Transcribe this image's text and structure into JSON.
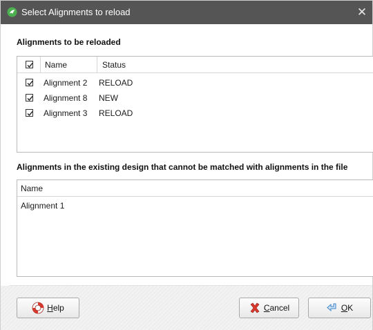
{
  "dialog": {
    "title": "Select Alignments to reload",
    "close_glyph": "✕"
  },
  "reload_section": {
    "heading": "Alignments to be reloaded",
    "columns": {
      "name": "Name",
      "status": "Status"
    },
    "header_checked": true,
    "rows": [
      {
        "checked": true,
        "name": "Alignment 2",
        "status": "RELOAD"
      },
      {
        "checked": true,
        "name": "Alignment 8",
        "status": "NEW"
      },
      {
        "checked": true,
        "name": "Alignment 3",
        "status": "RELOAD"
      }
    ]
  },
  "unmatched_section": {
    "heading": "Alignments in the existing design that cannot be matched with alignments in the file",
    "columns": {
      "name": "Name"
    },
    "rows": [
      {
        "name": "Alignment 1"
      }
    ]
  },
  "buttons": {
    "help": {
      "mnemonic": "H",
      "rest": "elp",
      "icon": "lifebuoy-icon"
    },
    "cancel": {
      "mnemonic": "C",
      "rest": "ancel",
      "icon": "red-x-icon"
    },
    "ok": {
      "mnemonic": "O",
      "rest": "K",
      "icon": "return-arrow-icon"
    }
  },
  "colors": {
    "titlebar": "#555555",
    "app_icon": "#4caf50",
    "lifebuoy": "#d9382c",
    "cancel_x": "#d9382c",
    "ok_arrow": "#3f86c9"
  }
}
